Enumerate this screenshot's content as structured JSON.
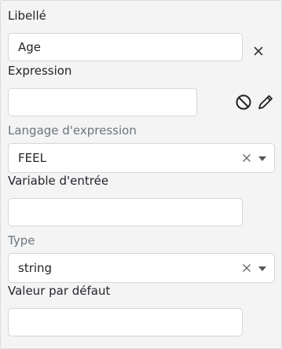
{
  "form": {
    "label_field": {
      "label": "Libellé",
      "value": "Age",
      "remove_icon": "close-icon"
    },
    "expression_field": {
      "label": "Expression",
      "value": "",
      "icons": [
        "no-entry-icon",
        "pencil-icon"
      ]
    },
    "expression_language": {
      "label": "Langage d'expression",
      "selected": "FEEL"
    },
    "input_variable": {
      "label": "Variable d'entrée",
      "value": ""
    },
    "type_field": {
      "label": "Type",
      "selected": "string"
    },
    "default_value": {
      "label": "Valeur par défaut",
      "value": ""
    }
  },
  "colors": {
    "background": "#f4f4f5",
    "input_border": "#d6d6d6",
    "muted_label": "#6c757d",
    "text": "#212529"
  }
}
